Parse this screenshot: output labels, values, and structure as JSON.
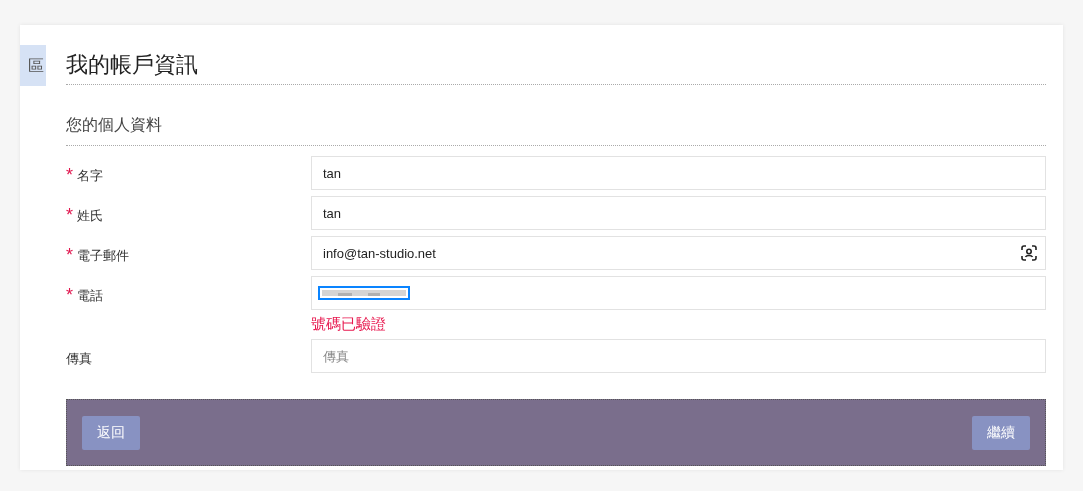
{
  "side_tab": {
    "label": "區"
  },
  "title": "我的帳戶資訊",
  "section": "您的個人資料",
  "fields": [
    {
      "label": "名字",
      "required_mark": "*",
      "kind": "text",
      "value": "tan"
    },
    {
      "label": "姓氏",
      "required_mark": "*",
      "kind": "text",
      "value": "tan"
    },
    {
      "label": "電子郵件",
      "required_mark": "*",
      "kind": "contact",
      "value": "info@tan-studio.net"
    },
    {
      "label": "電話",
      "required_mark": "*",
      "kind": "redacted",
      "note": "號碼已驗證"
    },
    {
      "label": "傳真",
      "kind": "text",
      "placeholder": "傳真"
    }
  ],
  "buttons": {
    "back": "返回",
    "next": "繼續"
  }
}
